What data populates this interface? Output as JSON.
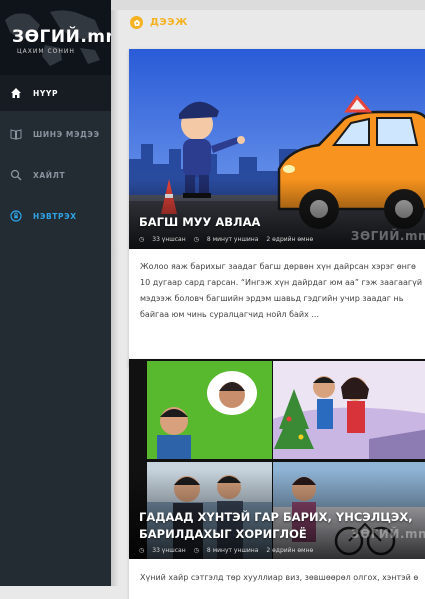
{
  "brand": {
    "logo": "ЗӨГИЙ.mn",
    "tagline": "ЦАХИМ СОНИН"
  },
  "nav": [
    {
      "label": "НҮҮР",
      "icon": "home-icon"
    },
    {
      "label": "ШИНЭ МЭДЭЭ",
      "icon": "book-icon"
    },
    {
      "label": "ХАЙЛТ",
      "icon": "search-icon"
    },
    {
      "label": "НЭВТРЭХ",
      "icon": "login-icon"
    }
  ],
  "category": {
    "title": "ДЭЭЖ",
    "icon": "category-badge-icon",
    "accent": "#f5b324"
  },
  "posts": [
    {
      "title": "БАГШ МУУ АВЛАА",
      "views": "33 үншсан",
      "read_time": "8 минут уншина",
      "date": "2 өдрийн өмнө",
      "watermark": "ЗӨГИЙ.mn",
      "excerpt": "Жолоо яаж барихыг заадаг багш дөрвөн хүн дайрсан хэрэг өнгө\n10 дугаар сард гарсан. “Ингэж хүн дайрдаг юм аа” гэж заагаагүй\nмэдээж боловч багшийн эрдэм шавьд гэдгийн учир заадаг нь\nбайгаа юм чинь суралцагчид нойл байх ..."
    },
    {
      "title": "ГАДААД ХҮНТЭЙ ГАР БАРИХ, ҮНСЭЛЦЭХ, БАРИЛДАХЫГ ХОРИГЛОЁ",
      "views": "33 үншсан",
      "read_time": "8 минут уншина",
      "date": "2 өдрийн өмнө",
      "watermark": "ЗӨГИЙ.mn",
      "excerpt": "Хүний хайр сэтгэлд төр хууллиар виз, зөвшөөрөл олгох, хэнтэй ө"
    }
  ],
  "colors": {
    "sidebar": "#232b33",
    "accent_blue": "#2fa4e7",
    "taxi": "#f7931e"
  }
}
